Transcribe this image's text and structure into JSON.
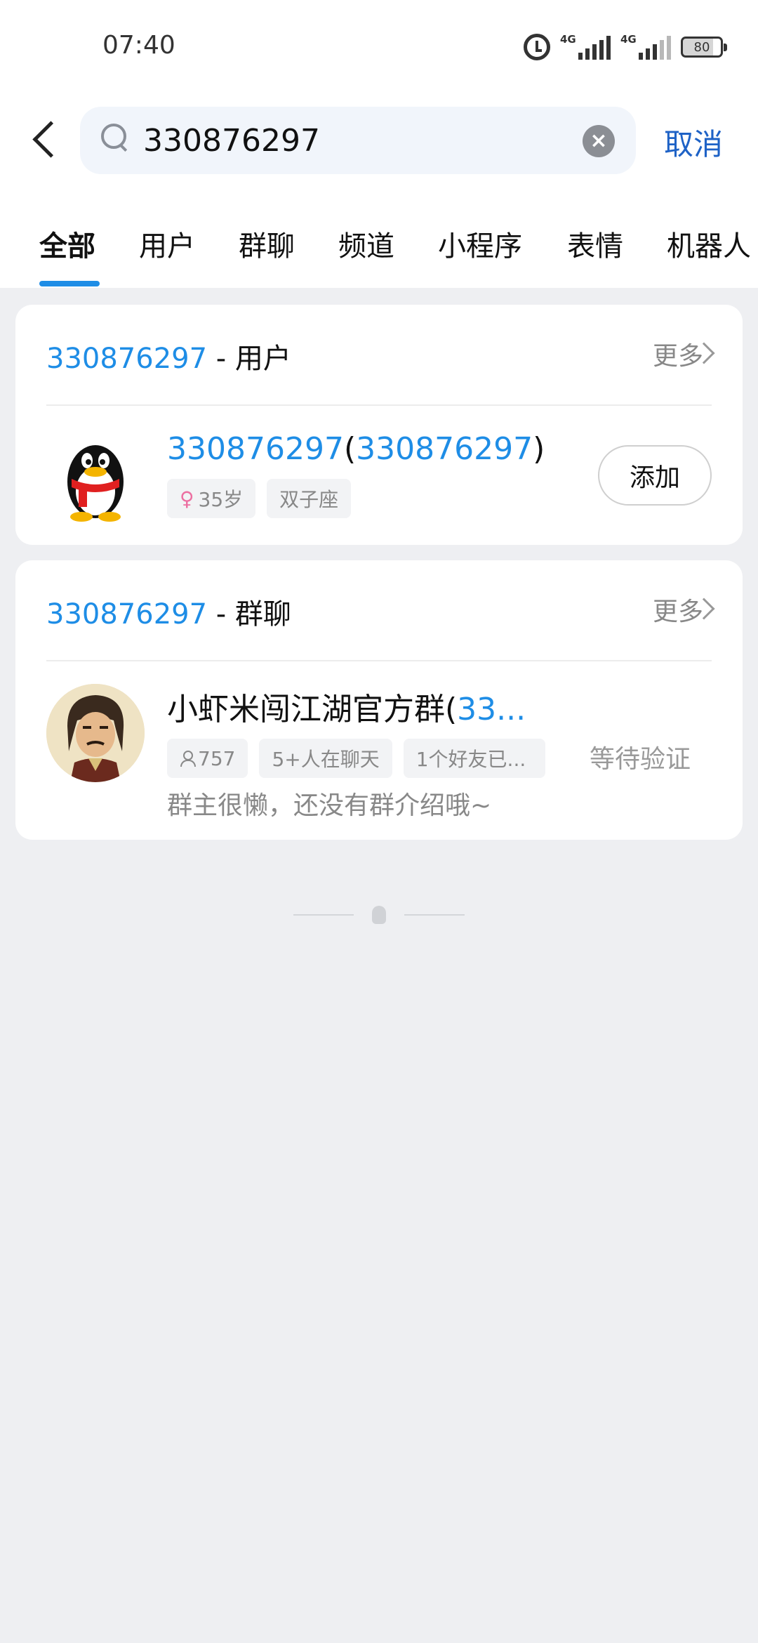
{
  "status_bar": {
    "time": "07:40",
    "network1": "4G",
    "network2": "4G",
    "battery": "80",
    "icons": [
      "alarm-icon",
      "signal-icon",
      "signal-icon",
      "battery-icon"
    ]
  },
  "search": {
    "query": "330876297",
    "placeholder": "",
    "cancel_label": "取消"
  },
  "tabs": [
    {
      "label": "全部",
      "active": true
    },
    {
      "label": "用户",
      "active": false
    },
    {
      "label": "群聊",
      "active": false
    },
    {
      "label": "频道",
      "active": false
    },
    {
      "label": "小程序",
      "active": false
    },
    {
      "label": "表情",
      "active": false
    },
    {
      "label": "机器人",
      "active": false
    }
  ],
  "user_section": {
    "keyword": "330876297",
    "category": "- 用户",
    "more_label": "更多",
    "result": {
      "name": "330876297",
      "paren_open": "(",
      "id": "330876297",
      "paren_close": ")",
      "age_tag": "35岁",
      "zodiac_tag": "双子座",
      "add_label": "添加",
      "avatar_icon": "qq-penguin-avatar"
    }
  },
  "group_section": {
    "keyword": "330876297",
    "category": "- 群聊",
    "more_label": "更多",
    "result": {
      "name": "小虾米闯江湖官方群(",
      "id_fragment": "33...",
      "member_count": "757",
      "chatting_tag": "5+人在聊天",
      "friends_tag": "1个好友已...",
      "status": "等待验证",
      "description": "群主很懒，还没有群介绍哦~"
    }
  },
  "colors": {
    "accent": "#1e8de6",
    "cancel": "#1e62c6",
    "background": "#eeeff2"
  }
}
